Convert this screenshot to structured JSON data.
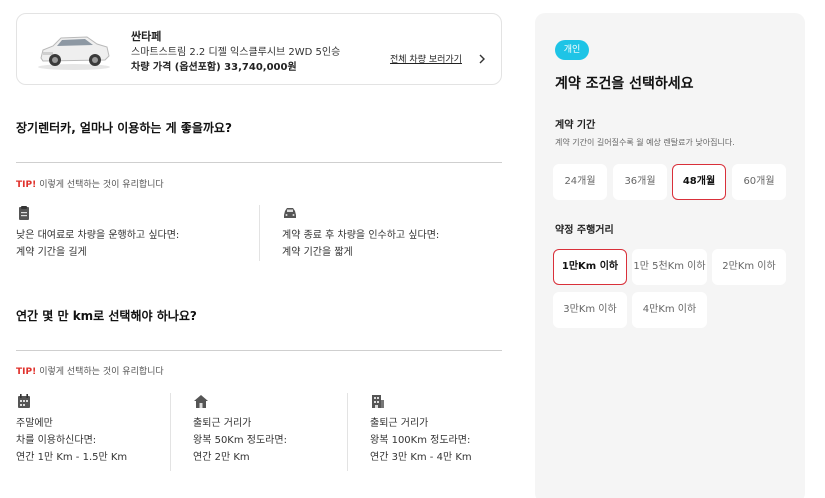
{
  "car": {
    "model": "싼타페",
    "trim": "스마트스트림 2.2 디젤 익스클루시브 2WD 5인승",
    "price": "차량 가격 (옵션포함) 33,740,000원",
    "view_all": "전체 차량 보러가기"
  },
  "period_section": {
    "title": "장기렌터카, 얼마나 이용하는 게 좋을까요?",
    "tip_label": "TIP!",
    "tip_text": "이렇게 선택하는 것이 유리합니다",
    "items": [
      {
        "icon": "document-icon",
        "line1": "낮은 대여료로 차량을 운행하고 싶다면:",
        "line2": "계약 기간을 길게"
      },
      {
        "icon": "car-icon",
        "line1": "계약 종료 후 차량을 인수하고 싶다면:",
        "line2": "계약 기간을 짧게"
      }
    ]
  },
  "mileage_section": {
    "title": "연간 몇 만 km로 선택해야 하나요?",
    "tip_label": "TIP!",
    "tip_text": "이렇게 선택하는 것이 유리합니다",
    "items": [
      {
        "icon": "calendar-icon",
        "line1": "주말에만",
        "line2": "차를 이용하신다면:",
        "line3": "연간 1만 Km - 1.5만 Km"
      },
      {
        "icon": "house-icon",
        "line1": "출퇴근 거리가",
        "line2": "왕복 50Km 정도라면:",
        "line3": "연간 2만 Km"
      },
      {
        "icon": "building-icon",
        "line1": "출퇴근 거리가",
        "line2": "왕복 100Km 정도라면:",
        "line3": "연간 3만 Km - 4만 Km"
      }
    ]
  },
  "panel": {
    "badge": "개인",
    "title": "계약 조건을 선택하세요",
    "period_title": "계약 기간",
    "period_desc": "계약 기간이 길어질수록 월 예상 렌탈료가 낮아집니다.",
    "period_options": [
      "24개월",
      "36개월",
      "48개월",
      "60개월"
    ],
    "period_selected": "48개월",
    "mileage_title": "약정 주행거리",
    "mileage_options": [
      "1만Km 이하",
      "1만 5천Km 이하",
      "2만Km 이하",
      "3만Km 이하",
      "4만Km 이하"
    ],
    "mileage_selected": "1만Km 이하"
  },
  "colors": {
    "accent_red": "#d9303a",
    "badge_cyan": "#1ec4e6",
    "tip_red": "#e0312b",
    "panel_bg": "#f5f5f5"
  }
}
